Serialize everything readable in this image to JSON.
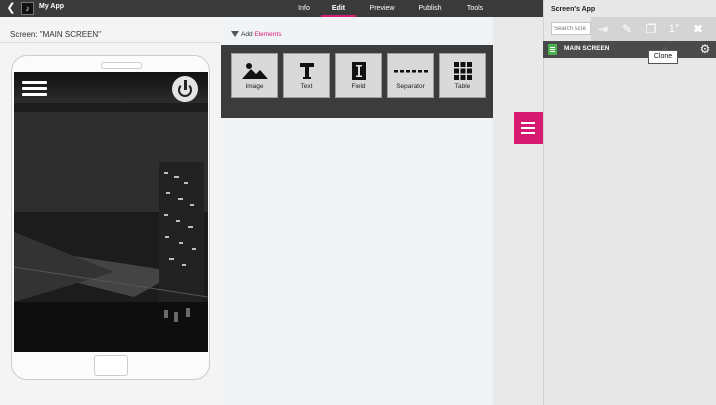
{
  "topbar": {
    "back_icon": "chevron-left-icon",
    "app_icon": "music-note-icon",
    "app_name": "My App",
    "tabs": [
      {
        "label": "Info"
      },
      {
        "label": "Edit",
        "active": true
      },
      {
        "label": "Preview"
      },
      {
        "label": "Publish"
      },
      {
        "label": "Tools"
      }
    ]
  },
  "screen": {
    "label": "Screen: \"MAIN SCREEN\""
  },
  "phone": {
    "menu_icon": "hamburger-icon",
    "power_icon": "power-icon"
  },
  "add_elements": {
    "prefix": "Add ",
    "link": "Elements",
    "items": [
      {
        "label": "Image",
        "icon": "image-icon"
      },
      {
        "label": "Text",
        "icon": "text-icon"
      },
      {
        "label": "Field",
        "icon": "field-icon"
      },
      {
        "label": "Separator",
        "icon": "separator-icon"
      },
      {
        "label": "Table",
        "icon": "table-icon"
      }
    ]
  },
  "right_panel": {
    "title": "Screen's App",
    "search_placeholder": "Search scre",
    "toolbar_icons": [
      "enter-icon",
      "pencil-icon",
      "clone-icon",
      "first-icon",
      "trash-icon"
    ],
    "first_label": "1°",
    "screens": [
      {
        "name": "MAIN SCREEN"
      }
    ],
    "tooltip": "Clone"
  },
  "colors": {
    "accent": "#d61a6f",
    "topbar": "#3a3a3a",
    "row_bg": "#4a4a4a"
  }
}
